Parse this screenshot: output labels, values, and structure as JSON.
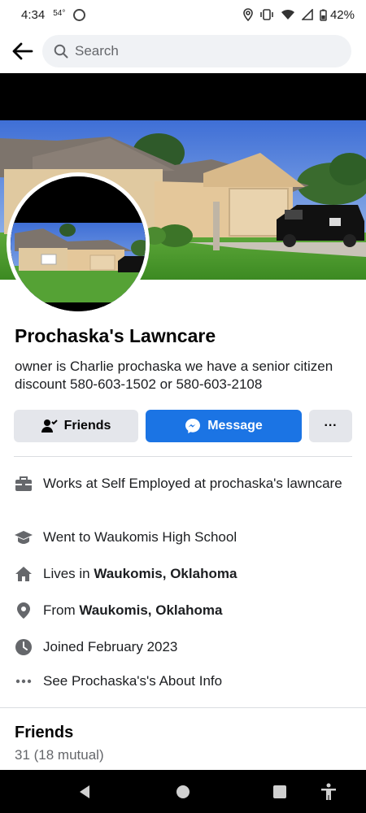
{
  "status_bar": {
    "time": "4:34",
    "temperature": "54°",
    "battery": "42%",
    "icons": [
      "location-icon",
      "vibrate-icon",
      "wifi-icon",
      "signal-icon",
      "battery-icon"
    ]
  },
  "header": {
    "back_icon": "arrow-left-icon",
    "search_placeholder": "Search"
  },
  "profile": {
    "name": "Prochaska's Lawncare",
    "bio": "owner is Charlie prochaska we have a  senior citizen discount 580-603-1502 or 580-603-2108"
  },
  "actions": {
    "friends_label": "Friends",
    "message_label": "Message",
    "more_label": "···"
  },
  "details": [
    {
      "icon": "briefcase-icon",
      "text": "Works at Self Employed at prochaska's lawncare"
    },
    {
      "icon": "graduation-cap-icon",
      "prefix": "Went to Waukomis High School"
    },
    {
      "icon": "home-icon",
      "prefix": "Lives in ",
      "bold": "Waukomis, Oklahoma"
    },
    {
      "icon": "location-pin-icon",
      "prefix": "From ",
      "bold": "Waukomis, Oklahoma"
    },
    {
      "icon": "clock-icon",
      "text": "Joined February 2023"
    },
    {
      "icon": "more-dots-icon",
      "text": "See Prochaska's's About Info"
    }
  ],
  "friends_section": {
    "title": "Friends",
    "count": "31 (18 mutual)"
  },
  "nav": [
    "back-triangle-icon",
    "home-circle-icon",
    "recents-square-icon",
    "accessibility-icon"
  ],
  "colors": {
    "accent": "#1b74e4",
    "button_gray": "#e4e6eb",
    "secondary_text": "#65676b"
  }
}
